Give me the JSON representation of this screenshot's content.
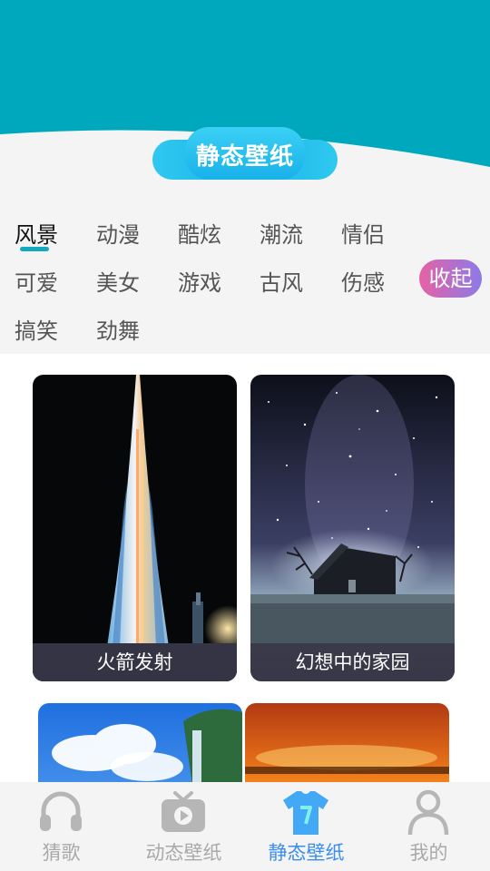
{
  "header": {
    "title": "静态壁纸",
    "bg_color": "#00a8bd"
  },
  "categories": {
    "items": [
      "风景",
      "动漫",
      "酷炫",
      "潮流",
      "情侣",
      "可爱",
      "美女",
      "游戏",
      "古风",
      "伤感",
      "搞笑",
      "劲舞"
    ],
    "active": "风景",
    "collapse_label": "收起"
  },
  "wallpapers": [
    {
      "caption": "火箭发射",
      "icon": "night-tower-image"
    },
    {
      "caption": "幻想中的家园",
      "icon": "starry-house-image"
    },
    {
      "caption": "",
      "icon": "waterfall-sky-image"
    },
    {
      "caption": "",
      "icon": "sunset-image"
    }
  ],
  "nav": {
    "items": [
      {
        "label": "猜歌",
        "icon": "headphones-icon"
      },
      {
        "label": "动态壁纸",
        "icon": "tv-play-icon"
      },
      {
        "label": "静态壁纸",
        "icon": "tshirt-icon"
      },
      {
        "label": "我的",
        "icon": "person-icon"
      }
    ],
    "active_color": "#3b8ef0",
    "inactive_color": "#a9a9a9"
  }
}
